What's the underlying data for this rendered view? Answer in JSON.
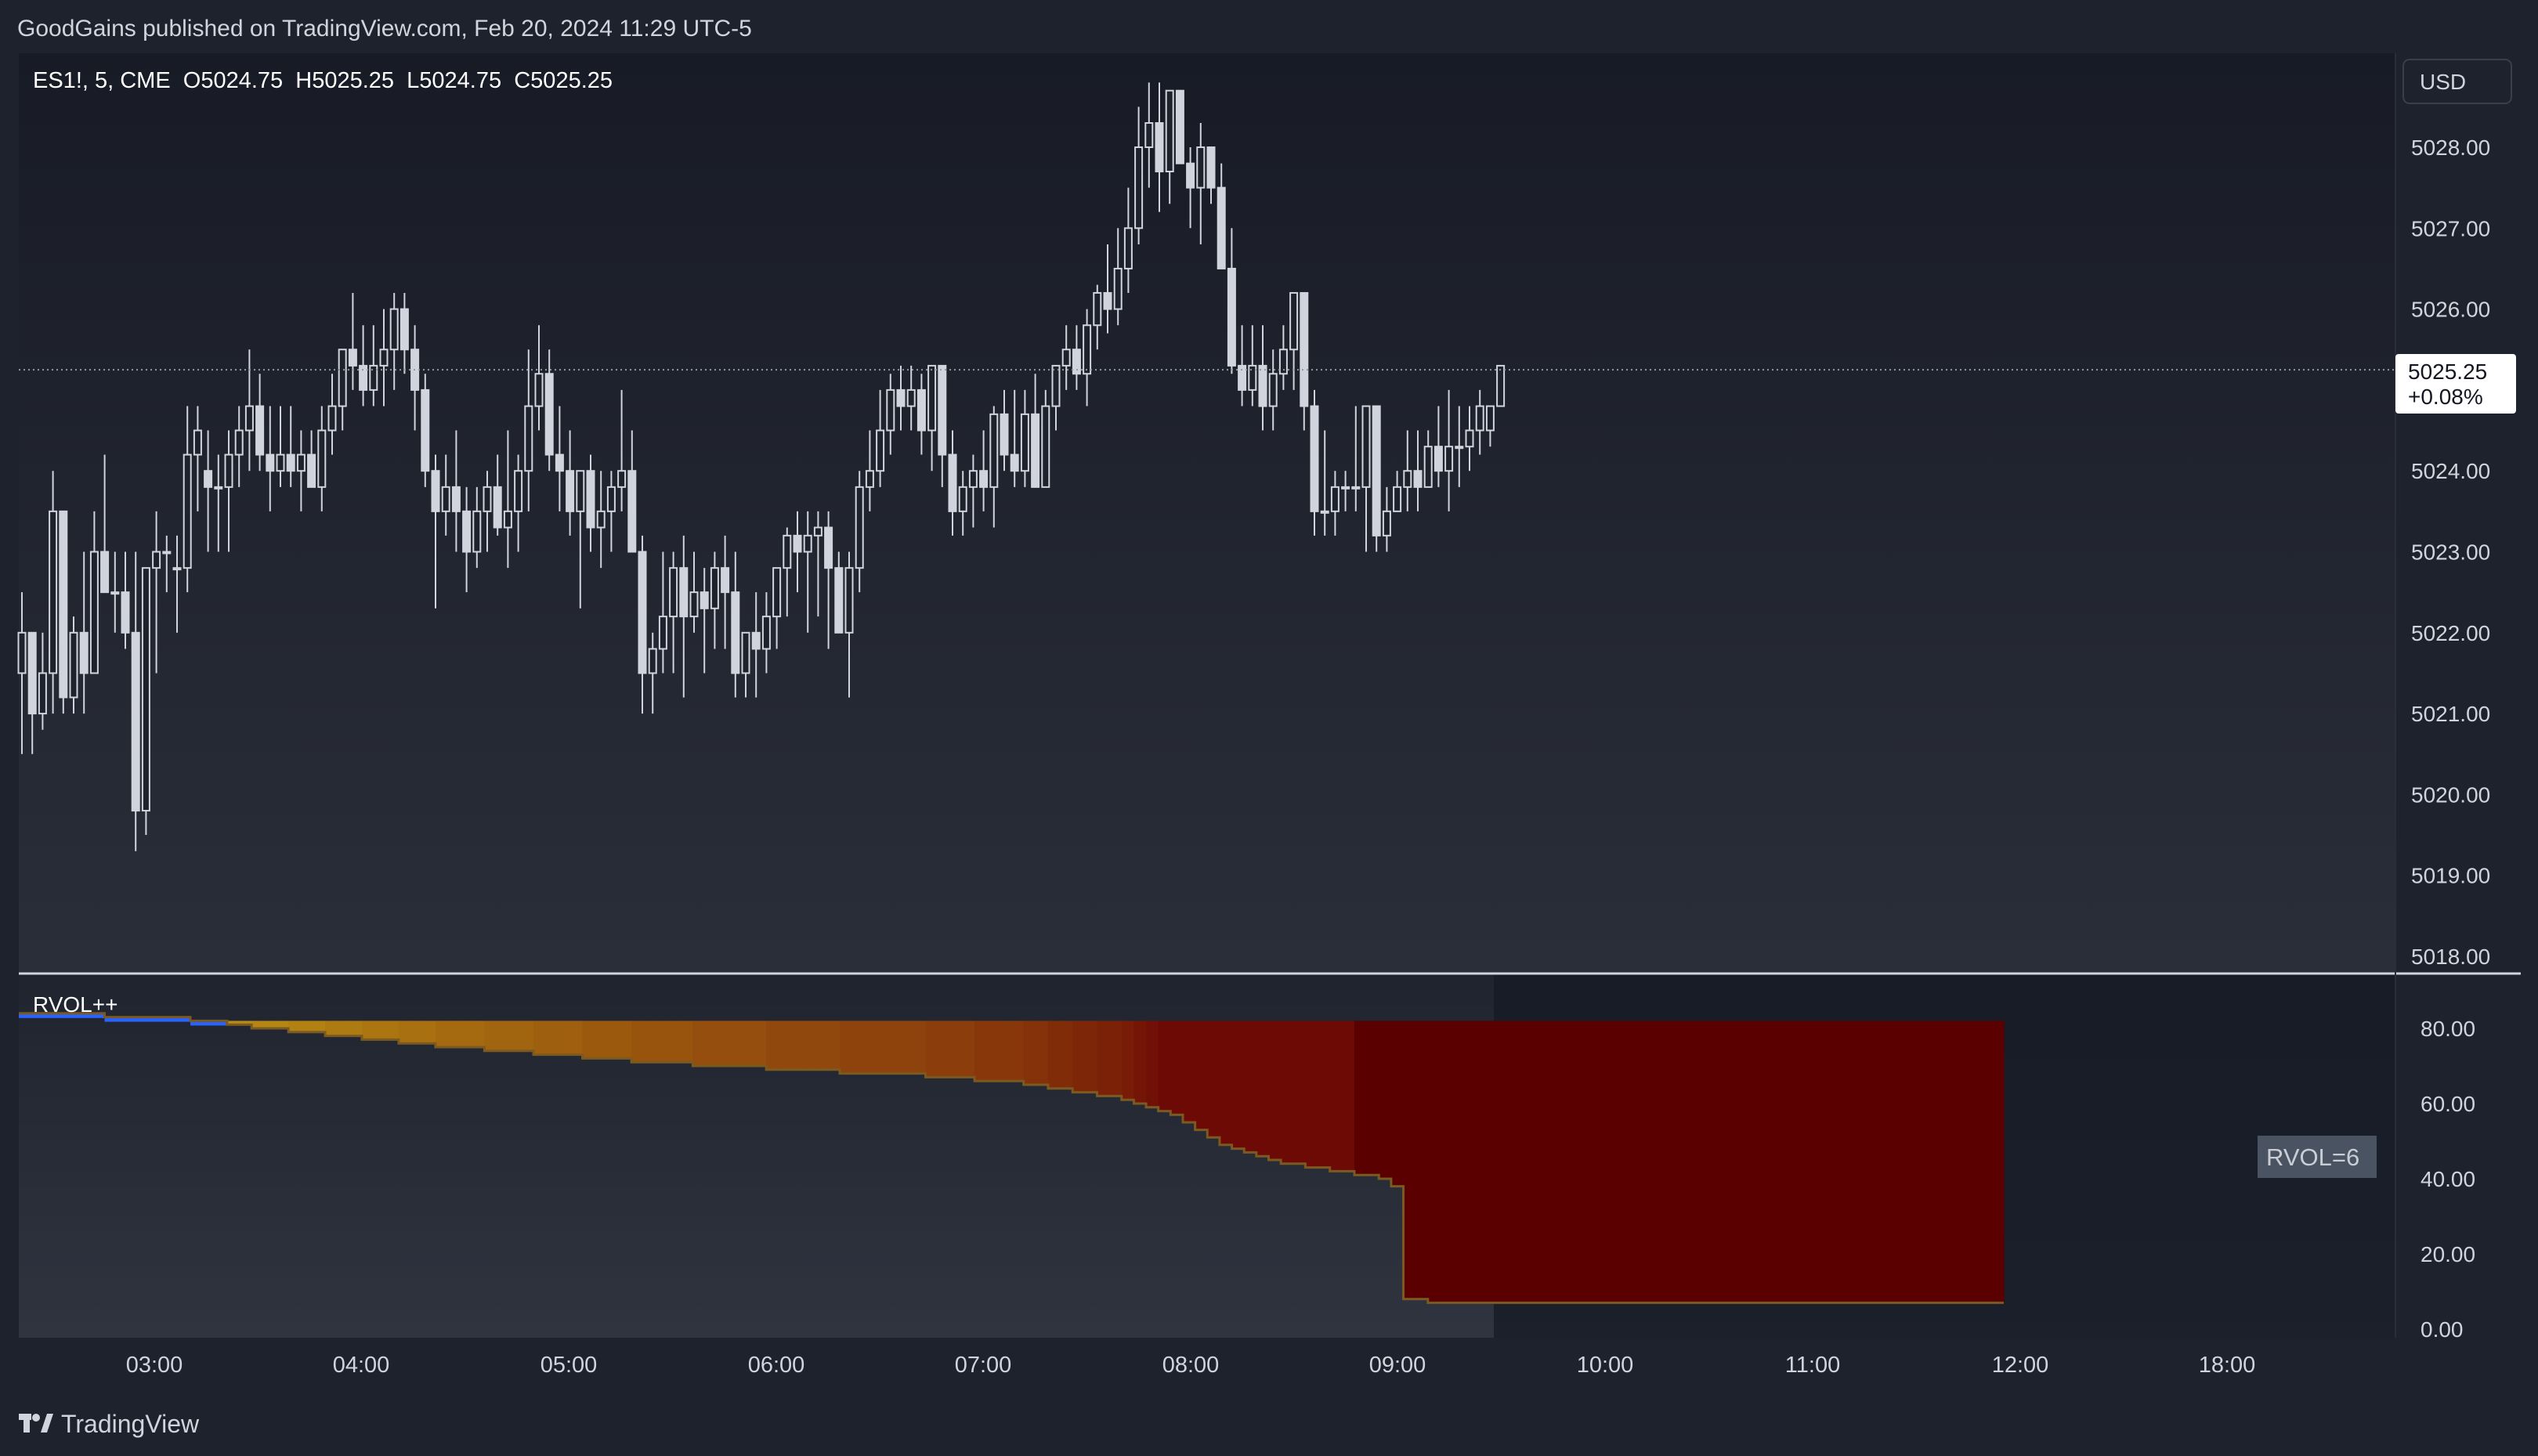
{
  "header": {
    "published": "GoodGains published on TradingView.com, Feb 20, 2024 11:29 UTC-5"
  },
  "footer": {
    "brand": "TradingView"
  },
  "main_pane": {
    "symbol_line": "ES1!, 5, CME  O5024.75  H5025.25  L5024.75  C5025.25",
    "currency": "USD",
    "last_price": "5025.25",
    "last_change": "+0.08%"
  },
  "indicator_pane": {
    "name": "RVOL++",
    "badge": "RVOL=6"
  },
  "colors": {
    "background": "#1e222d",
    "candle_border": "#d1d4dc",
    "candle_fill_down": "#d1d4dc",
    "rvol_blue": "#2962ff",
    "rvol_gold": "#b8860b",
    "rvol_red": "#5a0000"
  },
  "chart_data": [
    {
      "type": "candlestick",
      "title": "ES1!, 5, CME",
      "y_ticks": [
        "5018.00",
        "5019.00",
        "5020.00",
        "5021.00",
        "5022.00",
        "5023.00",
        "5024.00",
        "5025.00",
        "5026.00",
        "5027.00",
        "5028.00"
      ],
      "ylim": [
        5018,
        5029
      ],
      "x_ticks": [
        "03:00",
        "04:00",
        "05:00",
        "06:00",
        "07:00",
        "08:00",
        "09:00",
        "10:00",
        "11:00",
        "12:00",
        "18:00"
      ],
      "candles": [
        [
          5021.5,
          5022.5,
          5020.5,
          5022.0
        ],
        [
          5022.0,
          5022.0,
          5020.5,
          5021.0
        ],
        [
          5021.0,
          5022.0,
          5020.8,
          5021.5
        ],
        [
          5021.5,
          5024.0,
          5021.0,
          5023.5
        ],
        [
          5023.5,
          5023.5,
          5021.0,
          5021.2
        ],
        [
          5021.2,
          5022.2,
          5021.0,
          5022.0
        ],
        [
          5022.0,
          5023.0,
          5021.0,
          5021.5
        ],
        [
          5021.5,
          5023.5,
          5021.5,
          5023.0
        ],
        [
          5023.0,
          5024.2,
          5022.8,
          5022.5
        ],
        [
          5022.5,
          5023.0,
          5022.0,
          5022.5
        ],
        [
          5022.5,
          5023.0,
          5021.8,
          5022.0
        ],
        [
          5022.0,
          5023.0,
          5019.3,
          5019.8
        ],
        [
          5019.8,
          5022.8,
          5019.5,
          5022.8
        ],
        [
          5022.8,
          5023.5,
          5021.5,
          5023.0
        ],
        [
          5023.0,
          5023.2,
          5022.5,
          5023.0
        ],
        [
          5022.8,
          5023.2,
          5022.0,
          5022.8
        ],
        [
          5022.8,
          5024.8,
          5022.5,
          5024.2
        ],
        [
          5024.2,
          5024.8,
          5023.5,
          5024.5
        ],
        [
          5024.0,
          5024.5,
          5023.0,
          5023.8
        ],
        [
          5023.8,
          5024.2,
          5023.0,
          5023.8
        ],
        [
          5023.8,
          5024.5,
          5023.0,
          5024.2
        ],
        [
          5024.2,
          5024.8,
          5023.8,
          5024.5
        ],
        [
          5024.5,
          5025.5,
          5024.0,
          5024.8
        ],
        [
          5024.8,
          5025.2,
          5024.0,
          5024.2
        ],
        [
          5024.2,
          5024.8,
          5023.5,
          5024.0
        ],
        [
          5024.0,
          5024.8,
          5023.8,
          5024.2
        ],
        [
          5024.2,
          5024.8,
          5023.8,
          5024.0
        ],
        [
          5024.0,
          5024.5,
          5023.5,
          5024.2
        ],
        [
          5024.2,
          5024.5,
          5023.8,
          5023.8
        ],
        [
          5023.8,
          5024.8,
          5023.5,
          5024.5
        ],
        [
          5024.5,
          5025.2,
          5024.2,
          5024.8
        ],
        [
          5024.8,
          5025.5,
          5024.5,
          5025.5
        ],
        [
          5025.5,
          5026.2,
          5025.0,
          5025.3
        ],
        [
          5025.3,
          5025.8,
          5024.8,
          5025.0
        ],
        [
          5025.0,
          5025.8,
          5024.8,
          5025.3
        ],
        [
          5025.3,
          5026.0,
          5024.8,
          5025.5
        ],
        [
          5025.5,
          5026.2,
          5025.0,
          5026.0
        ],
        [
          5026.0,
          5026.2,
          5025.2,
          5025.5
        ],
        [
          5025.5,
          5025.8,
          5024.5,
          5025.0
        ],
        [
          5025.0,
          5025.2,
          5023.8,
          5024.0
        ],
        [
          5024.0,
          5024.2,
          5022.3,
          5023.5
        ],
        [
          5023.5,
          5024.2,
          5023.2,
          5023.8
        ],
        [
          5023.8,
          5024.5,
          5023.0,
          5023.5
        ],
        [
          5023.5,
          5023.8,
          5022.5,
          5023.0
        ],
        [
          5023.0,
          5023.8,
          5022.8,
          5023.5
        ],
        [
          5023.5,
          5024.0,
          5023.0,
          5023.8
        ],
        [
          5023.8,
          5024.2,
          5023.2,
          5023.3
        ],
        [
          5023.3,
          5024.5,
          5022.8,
          5023.5
        ],
        [
          5023.5,
          5024.2,
          5023.0,
          5024.0
        ],
        [
          5024.0,
          5025.5,
          5023.5,
          5024.8
        ],
        [
          5024.8,
          5025.8,
          5024.5,
          5025.2
        ],
        [
          5025.2,
          5025.5,
          5024.0,
          5024.2
        ],
        [
          5024.2,
          5024.8,
          5023.5,
          5024.0
        ],
        [
          5024.0,
          5024.5,
          5023.2,
          5023.5
        ],
        [
          5023.5,
          5024.0,
          5022.3,
          5024.0
        ],
        [
          5024.0,
          5024.2,
          5023.0,
          5023.3
        ],
        [
          5023.3,
          5024.0,
          5022.8,
          5023.5
        ],
        [
          5023.5,
          5024.0,
          5023.0,
          5023.8
        ],
        [
          5023.8,
          5025.0,
          5023.5,
          5024.0
        ],
        [
          5024.0,
          5024.5,
          5023.0,
          5023.0
        ],
        [
          5023.0,
          5023.2,
          5021.0,
          5021.5
        ],
        [
          5021.5,
          5022.0,
          5021.0,
          5021.8
        ],
        [
          5021.8,
          5023.0,
          5021.5,
          5022.2
        ],
        [
          5022.2,
          5023.0,
          5021.5,
          5022.8
        ],
        [
          5022.8,
          5023.2,
          5021.2,
          5022.2
        ],
        [
          5022.2,
          5023.0,
          5022.0,
          5022.5
        ],
        [
          5022.5,
          5022.8,
          5021.5,
          5022.3
        ],
        [
          5022.3,
          5023.0,
          5021.8,
          5022.8
        ],
        [
          5022.8,
          5023.2,
          5021.8,
          5022.5
        ],
        [
          5022.5,
          5023.0,
          5021.2,
          5021.5
        ],
        [
          5021.5,
          5022.0,
          5021.2,
          5022.0
        ],
        [
          5022.0,
          5022.5,
          5021.2,
          5021.8
        ],
        [
          5021.8,
          5022.5,
          5021.5,
          5022.2
        ],
        [
          5022.2,
          5022.8,
          5021.8,
          5022.8
        ],
        [
          5022.8,
          5023.3,
          5022.2,
          5023.2
        ],
        [
          5023.2,
          5023.5,
          5022.5,
          5023.0
        ],
        [
          5023.0,
          5023.5,
          5022.0,
          5023.2
        ],
        [
          5023.2,
          5023.5,
          5022.2,
          5023.3
        ],
        [
          5023.3,
          5023.5,
          5021.8,
          5022.8
        ],
        [
          5022.8,
          5023.0,
          5022.0,
          5022.0
        ],
        [
          5022.0,
          5023.0,
          5021.2,
          5022.8
        ],
        [
          5022.8,
          5024.0,
          5022.5,
          5023.8
        ],
        [
          5023.8,
          5024.5,
          5023.5,
          5024.0
        ],
        [
          5024.0,
          5025.0,
          5023.8,
          5024.5
        ],
        [
          5024.5,
          5025.2,
          5024.2,
          5025.0
        ],
        [
          5025.0,
          5025.3,
          5024.5,
          5024.8
        ],
        [
          5024.8,
          5025.3,
          5024.5,
          5025.0
        ],
        [
          5025.0,
          5025.2,
          5024.2,
          5024.5
        ],
        [
          5024.5,
          5025.3,
          5024.0,
          5025.3
        ],
        [
          5025.3,
          5025.3,
          5023.8,
          5024.2
        ],
        [
          5024.2,
          5024.5,
          5023.2,
          5023.5
        ],
        [
          5023.5,
          5024.0,
          5023.2,
          5023.8
        ],
        [
          5023.8,
          5024.2,
          5023.3,
          5024.0
        ],
        [
          5024.0,
          5024.5,
          5023.5,
          5023.8
        ],
        [
          5023.8,
          5024.8,
          5023.3,
          5024.7
        ],
        [
          5024.7,
          5025.0,
          5024.0,
          5024.2
        ],
        [
          5024.2,
          5025.0,
          5023.8,
          5024.0
        ],
        [
          5024.0,
          5025.0,
          5023.8,
          5024.7
        ],
        [
          5024.7,
          5025.2,
          5023.8,
          5023.8
        ],
        [
          5023.8,
          5025.0,
          5023.8,
          5024.8
        ],
        [
          5024.8,
          5025.3,
          5024.5,
          5025.3
        ],
        [
          5025.3,
          5025.8,
          5025.0,
          5025.5
        ],
        [
          5025.5,
          5025.8,
          5025.0,
          5025.2
        ],
        [
          5025.2,
          5026.0,
          5024.8,
          5025.8
        ],
        [
          5025.8,
          5026.3,
          5025.5,
          5026.2
        ],
        [
          5026.2,
          5026.8,
          5025.7,
          5026.0
        ],
        [
          5026.0,
          5027.0,
          5025.8,
          5026.5
        ],
        [
          5026.5,
          5027.5,
          5026.2,
          5027.0
        ],
        [
          5027.0,
          5028.5,
          5026.8,
          5028.0
        ],
        [
          5028.0,
          5028.8,
          5027.5,
          5028.3
        ],
        [
          5028.3,
          5028.8,
          5027.2,
          5027.7
        ],
        [
          5027.7,
          5028.7,
          5027.3,
          5028.7
        ],
        [
          5028.7,
          5028.7,
          5027.8,
          5027.8
        ],
        [
          5027.8,
          5028.0,
          5027.0,
          5027.5
        ],
        [
          5027.5,
          5028.3,
          5026.8,
          5028.0
        ],
        [
          5028.0,
          5028.0,
          5027.3,
          5027.5
        ],
        [
          5027.5,
          5027.8,
          5026.5,
          5026.5
        ],
        [
          5026.5,
          5027.0,
          5025.2,
          5025.3
        ],
        [
          5025.3,
          5025.8,
          5024.8,
          5025.0
        ],
        [
          5025.0,
          5025.8,
          5024.8,
          5025.3
        ],
        [
          5025.3,
          5025.8,
          5024.5,
          5024.8
        ],
        [
          5024.8,
          5025.5,
          5024.5,
          5025.2
        ],
        [
          5025.2,
          5025.8,
          5025.0,
          5025.5
        ],
        [
          5025.5,
          5026.2,
          5025.0,
          5026.2
        ],
        [
          5026.2,
          5026.2,
          5024.5,
          5024.8
        ],
        [
          5024.8,
          5025.0,
          5023.2,
          5023.5
        ],
        [
          5023.5,
          5024.5,
          5023.2,
          5023.5
        ],
        [
          5023.5,
          5024.0,
          5023.2,
          5023.8
        ],
        [
          5023.8,
          5024.0,
          5023.5,
          5023.8
        ],
        [
          5023.8,
          5024.8,
          5023.5,
          5023.8
        ],
        [
          5023.8,
          5024.8,
          5023.0,
          5024.8
        ],
        [
          5024.8,
          5024.8,
          5023.0,
          5023.2
        ],
        [
          5023.2,
          5023.8,
          5023.0,
          5023.5
        ],
        [
          5023.5,
          5024.0,
          5023.5,
          5023.8
        ],
        [
          5023.8,
          5024.5,
          5023.5,
          5024.0
        ],
        [
          5024.0,
          5024.5,
          5023.5,
          5023.8
        ],
        [
          5023.8,
          5024.5,
          5023.8,
          5024.3
        ],
        [
          5024.3,
          5024.8,
          5023.8,
          5024.0
        ],
        [
          5024.0,
          5025.0,
          5023.5,
          5024.3
        ],
        [
          5024.3,
          5024.8,
          5023.8,
          5024.3
        ],
        [
          5024.3,
          5024.8,
          5024.0,
          5024.5
        ],
        [
          5024.5,
          5025.0,
          5024.2,
          5024.8
        ],
        [
          5024.5,
          5024.8,
          5024.3,
          5024.8
        ],
        [
          5024.8,
          5025.3,
          5024.8,
          5025.3
        ]
      ]
    },
    {
      "type": "area",
      "title": "RVOL++",
      "y_ticks": [
        "0.00",
        "20.00",
        "40.00",
        "60.00",
        "80.00"
      ],
      "ylim": [
        0,
        85
      ],
      "ceiling": 82,
      "values": [
        84,
        84,
        84,
        84,
        84,
        84,
        84,
        83,
        83,
        83,
        83,
        83,
        83,
        83,
        82,
        82,
        82,
        81,
        81,
        80,
        80,
        80,
        79,
        79,
        79,
        78,
        78,
        78,
        77,
        77,
        77,
        76,
        76,
        76,
        75,
        75,
        75,
        75,
        74,
        74,
        74,
        74,
        73,
        73,
        73,
        73,
        72,
        72,
        72,
        72,
        71,
        71,
        71,
        71,
        71,
        70,
        70,
        70,
        70,
        70,
        70,
        69,
        69,
        69,
        69,
        69,
        69,
        68,
        68,
        68,
        68,
        68,
        68,
        68,
        67,
        67,
        67,
        67,
        66,
        66,
        66,
        66,
        65,
        65,
        64,
        64,
        63,
        63,
        62,
        62,
        61,
        60,
        59,
        58,
        57,
        55,
        53,
        51,
        49,
        48,
        47,
        46,
        45,
        44,
        44,
        43,
        43,
        42,
        42,
        41,
        41,
        40,
        38,
        8,
        8,
        7,
        7,
        7,
        7,
        7,
        7,
        7,
        7,
        7,
        7,
        7,
        7,
        7,
        7,
        7,
        7,
        7,
        7,
        7,
        7,
        7,
        7,
        7,
        7,
        7,
        7,
        7,
        7,
        7,
        7,
        7,
        7,
        7,
        7,
        7,
        7,
        7,
        7,
        7,
        7,
        7,
        7,
        7,
        7,
        7,
        7,
        7
      ]
    }
  ]
}
